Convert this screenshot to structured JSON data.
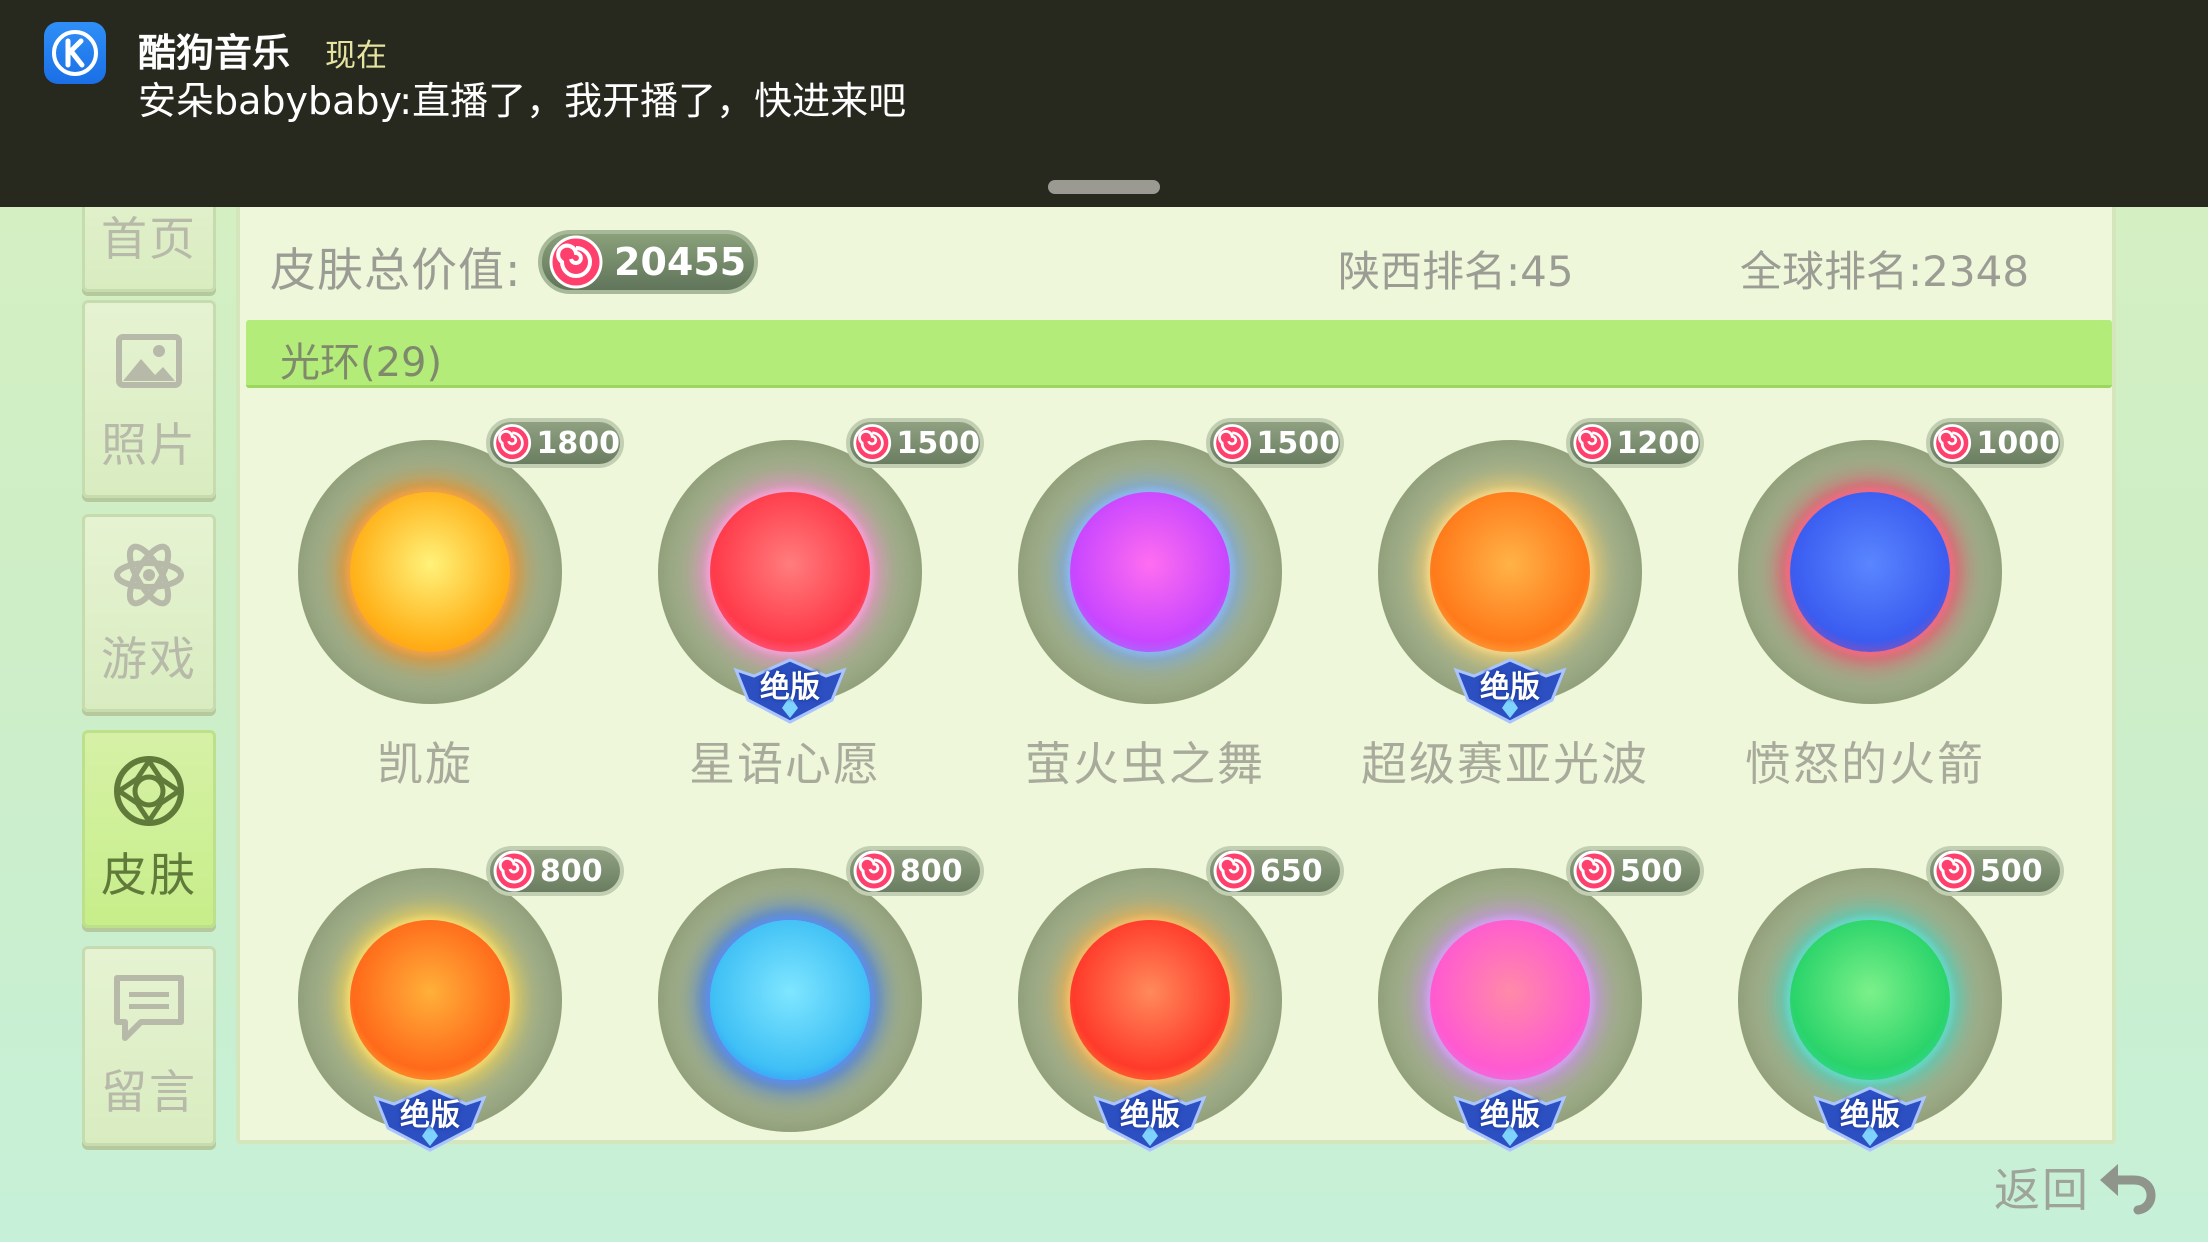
{
  "notification": {
    "app_name": "酷狗音乐",
    "time": "现在",
    "message": "安朵babybaby:直播了，我开播了，快进来吧",
    "app_icon": "kugou-k-icon"
  },
  "sidebar": {
    "items": [
      {
        "label": "首页",
        "icon": "home-icon",
        "active": false
      },
      {
        "label": "照片",
        "icon": "photo-icon",
        "active": false
      },
      {
        "label": "游戏",
        "icon": "atom-icon",
        "active": false
      },
      {
        "label": "皮肤",
        "icon": "gem-icon",
        "active": true
      },
      {
        "label": "留言",
        "icon": "message-icon",
        "active": false
      }
    ]
  },
  "header": {
    "total_value_label": "皮肤总价值:",
    "total_value": "20455",
    "rank_province": "陕西排名:45",
    "rank_global": "全球排名:2348"
  },
  "category": {
    "label": "光环(29)"
  },
  "skins": [
    {
      "name": "凯旋",
      "price": "1800",
      "badge": "",
      "colors": [
        "#fff27a",
        "#ffb21a",
        "#ff8a10"
      ]
    },
    {
      "name": "星语心愿",
      "price": "1500",
      "badge": "绝版",
      "colors": [
        "#ff7d7d",
        "#ff3a4a",
        "#ff8ad8"
      ]
    },
    {
      "name": "萤火虫之舞",
      "price": "1500",
      "badge": "",
      "colors": [
        "#ff6df0",
        "#c846ff",
        "#6fa8ff"
      ]
    },
    {
      "name": "超级赛亚光波",
      "price": "1200",
      "badge": "绝版",
      "colors": [
        "#ffb347",
        "#ff7a1a",
        "#ffd36b"
      ]
    },
    {
      "name": "愤怒的火箭",
      "price": "1000",
      "badge": "",
      "colors": [
        "#5a86ff",
        "#3a5cf0",
        "#ff3c66"
      ]
    },
    {
      "name": "",
      "price": "800",
      "badge": "绝版",
      "colors": [
        "#ffb03a",
        "#ff6a1a",
        "#ffd84a"
      ]
    },
    {
      "name": "",
      "price": "800",
      "badge": "",
      "colors": [
        "#7fe6ff",
        "#3fc0f5",
        "#2a6fff"
      ]
    },
    {
      "name": "",
      "price": "650",
      "badge": "绝版",
      "colors": [
        "#ff8a5a",
        "#ff3a2a",
        "#ffb040"
      ]
    },
    {
      "name": "",
      "price": "500",
      "badge": "绝版",
      "colors": [
        "#ff8aa8",
        "#ff5ad0",
        "#d28aff"
      ]
    },
    {
      "name": "",
      "price": "500",
      "badge": "绝版",
      "colors": [
        "#7cf08a",
        "#2ad46a",
        "#3ad8c8"
      ]
    }
  ],
  "footer": {
    "back_label": "返回",
    "back_icon": "return-arrow-icon"
  }
}
